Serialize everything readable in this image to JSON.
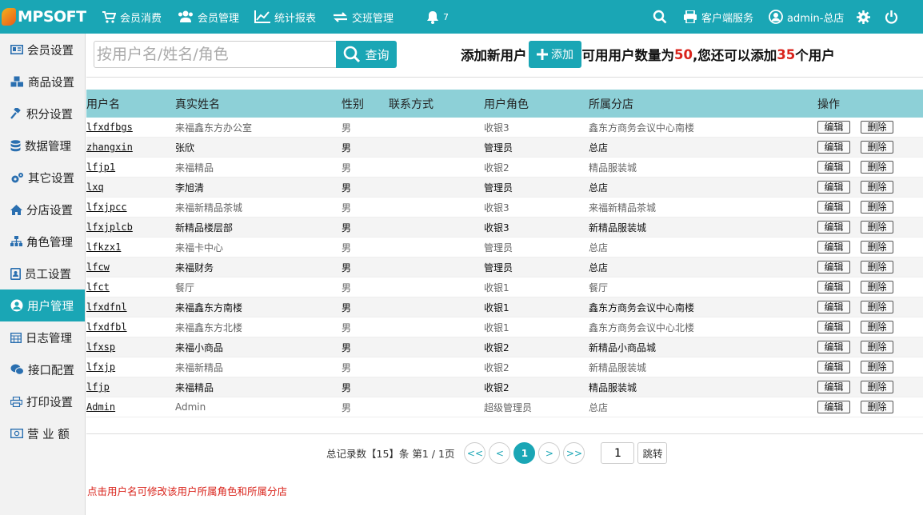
{
  "app": {
    "logo": "MPSOFT"
  },
  "topnav": [
    {
      "label": "会员消费",
      "icon": "cart-icon"
    },
    {
      "label": "会员管理",
      "icon": "users-icon"
    },
    {
      "label": "统计报表",
      "icon": "chart-icon"
    },
    {
      "label": "交班管理",
      "icon": "exchange-icon"
    }
  ],
  "notifications": {
    "count": "7"
  },
  "topright": {
    "service": "客户端服务",
    "user": "admin-总店"
  },
  "sidebar": [
    {
      "label": "会员设置",
      "icon": "card-icon"
    },
    {
      "label": "商品设置",
      "icon": "cubes-icon"
    },
    {
      "label": "积分设置",
      "icon": "gavel-icon"
    },
    {
      "label": "数据管理",
      "icon": "database-icon"
    },
    {
      "label": "其它设置",
      "icon": "cogs-icon"
    },
    {
      "label": "分店设置",
      "icon": "home-icon"
    },
    {
      "label": "角色管理",
      "icon": "sitemap-icon"
    },
    {
      "label": "员工设置",
      "icon": "badge-icon"
    },
    {
      "label": "用户管理",
      "icon": "user-circle-icon",
      "active": true
    },
    {
      "label": "日志管理",
      "icon": "calendar-icon"
    },
    {
      "label": "接口配置",
      "icon": "wechat-icon"
    },
    {
      "label": "打印设置",
      "icon": "print-icon"
    },
    {
      "label": "营 业 额",
      "icon": "money-icon"
    }
  ],
  "search": {
    "placeholder": "按用户名/姓名/角色",
    "value": "",
    "button": "查询"
  },
  "add": {
    "prefix": "添加新用户",
    "button": "添加",
    "text1": "可用用户数量为",
    "total": "50",
    "text2": ",您还可以添加",
    "remain": "35",
    "text3": "个用户"
  },
  "table": {
    "headers": [
      "用户名",
      "真实姓名",
      "性别",
      "联系方式",
      "用户角色",
      "所属分店",
      "操作"
    ],
    "edit_label": "编辑",
    "delete_label": "删除",
    "rows": [
      {
        "username": "lfxdfbgs",
        "name": "来福鑫东方办公室",
        "gender": "男",
        "contact": "",
        "role": "收银3",
        "store": "鑫东方商务会议中心南楼"
      },
      {
        "username": "zhangxin",
        "name": "张欣",
        "gender": "男",
        "contact": "",
        "role": "管理员",
        "store": "总店"
      },
      {
        "username": "lfjp1",
        "name": "来福精品",
        "gender": "男",
        "contact": "",
        "role": "收银2",
        "store": "精品服装城"
      },
      {
        "username": "lxq",
        "name": "李旭清",
        "gender": "男",
        "contact": "",
        "role": "管理员",
        "store": "总店"
      },
      {
        "username": "lfxjpcc",
        "name": "来福新精品茶城",
        "gender": "男",
        "contact": "",
        "role": "收银3",
        "store": "来福新精品茶城"
      },
      {
        "username": "lfxjplcb",
        "name": "新精品楼层部",
        "gender": "男",
        "contact": "",
        "role": "收银3",
        "store": "新精品服装城"
      },
      {
        "username": "lfkzx1",
        "name": "来福卡中心",
        "gender": "男",
        "contact": "",
        "role": "管理员",
        "store": "总店"
      },
      {
        "username": "lfcw",
        "name": "来福财务",
        "gender": "男",
        "contact": "",
        "role": "管理员",
        "store": "总店"
      },
      {
        "username": "lfct",
        "name": "餐厅",
        "gender": "男",
        "contact": "",
        "role": "收银1",
        "store": "餐厅"
      },
      {
        "username": "lfxdfnl",
        "name": "来福鑫东方南楼",
        "gender": "男",
        "contact": "",
        "role": "收银1",
        "store": "鑫东方商务会议中心南楼"
      },
      {
        "username": "lfxdfbl",
        "name": "来福鑫东方北楼",
        "gender": "男",
        "contact": "",
        "role": "收银1",
        "store": "鑫东方商务会议中心北楼"
      },
      {
        "username": "lfxsp",
        "name": "来福小商品",
        "gender": "男",
        "contact": "",
        "role": "收银2",
        "store": "新精品小商品城"
      },
      {
        "username": "lfxjp",
        "name": "来福新精品",
        "gender": "男",
        "contact": "",
        "role": "收银2",
        "store": "新精品服装城"
      },
      {
        "username": "lfjp",
        "name": "来福精品",
        "gender": "男",
        "contact": "",
        "role": "收银2",
        "store": "精品服装城"
      },
      {
        "username": "Admin",
        "name": "Admin",
        "gender": "男",
        "contact": "",
        "role": "超级管理员",
        "store": "总店"
      }
    ]
  },
  "pagination": {
    "summary": "总记录数【15】条 第1 / 1页",
    "first": "<<",
    "prev": "<",
    "current": "1",
    "next": ">",
    "last": ">>",
    "page_input": "1",
    "jump": "跳转"
  },
  "note": "点击用户名可修改该用户所属角色和所属分店",
  "colors": {
    "accent": "#1aa6b5",
    "header_row": "#8dd0d7",
    "red": "#d9231b"
  }
}
